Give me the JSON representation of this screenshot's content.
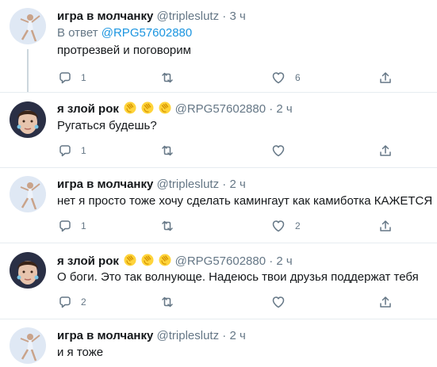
{
  "colors": {
    "text": "#14171a",
    "secondary": "#657786",
    "link": "#1b95e0",
    "line": "#ccd6dd"
  },
  "tweets": [
    {
      "name": "игра в молчанку",
      "handle": "@tripleslutz",
      "dot": "·",
      "time": "3 ч",
      "reply_prefix": "В ответ",
      "reply_mention": "@RPG57602880",
      "text": "протрезвей и поговорим",
      "replies": "1",
      "retweets": "",
      "likes": "6"
    },
    {
      "name": "я злой рок",
      "emoji": [
        "clapping-hands",
        "clapping-hands",
        "clapping-hands"
      ],
      "handle": "@RPG57602880",
      "dot": "·",
      "time": "2 ч",
      "text": "Ругаться будешь?",
      "replies": "1",
      "retweets": "",
      "likes": ""
    },
    {
      "name": "игра в молчанку",
      "handle": "@tripleslutz",
      "dot": "·",
      "time": "2 ч",
      "text": "нет я просто тоже хочу сделать камингаут как камиботка КАЖЕТСЯ",
      "replies": "1",
      "retweets": "",
      "likes": "2"
    },
    {
      "name": "я злой рок",
      "emoji": [
        "clapping-hands",
        "clapping-hands",
        "clapping-hands"
      ],
      "handle": "@RPG57602880",
      "dot": "·",
      "time": "2 ч",
      "text": "О боги. Это так волнующе. Надеюсь твои друзья поддержат тебя",
      "replies": "2",
      "retweets": "",
      "likes": ""
    },
    {
      "name": "игра в молчанку",
      "handle": "@tripleslutz",
      "dot": "·",
      "time": "2 ч",
      "text": "и я тоже"
    }
  ]
}
